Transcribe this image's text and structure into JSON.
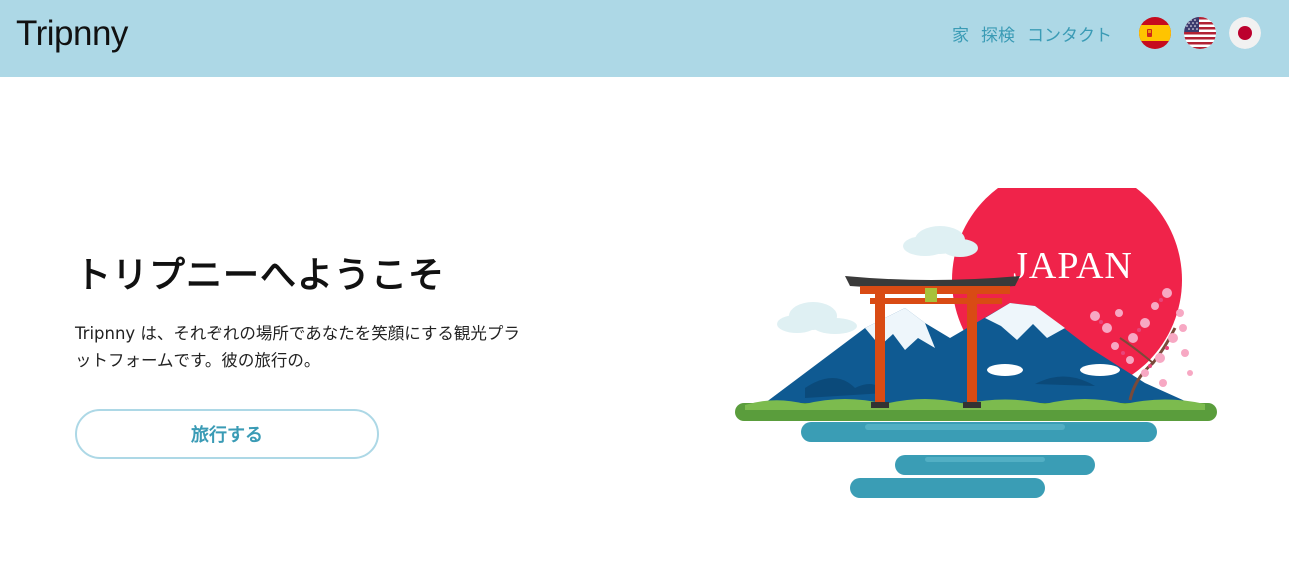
{
  "header": {
    "logo": "Tripnny",
    "nav": [
      {
        "label": "家"
      },
      {
        "label": "探検"
      },
      {
        "label": "コンタクト"
      }
    ],
    "flags": [
      {
        "icon": "spain-flag-icon"
      },
      {
        "icon": "usa-flag-icon"
      },
      {
        "icon": "japan-flag-icon"
      }
    ],
    "background": "#add8e6",
    "link_color": "#3a9bb5"
  },
  "hero": {
    "title": "トリプニーへようこそ",
    "text": "Tripnny は、それぞれの場所であなたを笑顔にする観光プラットフォームです。彼の旅行の。",
    "cta_label": "旅行する"
  },
  "illustration": {
    "label": "JAPAN",
    "sun_color": "#f0234a"
  }
}
